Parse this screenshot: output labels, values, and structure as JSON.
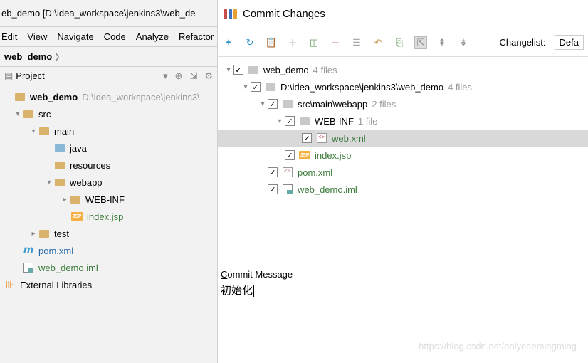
{
  "left": {
    "title": "eb_demo [D:\\idea_workspace\\jenkins3\\web_de",
    "menu": [
      "Edit",
      "View",
      "Navigate",
      "Code",
      "Analyze",
      "Refactor"
    ],
    "breadcrumb": "web_demo",
    "project_header": "Project",
    "tree": {
      "root": {
        "name": "web_demo",
        "path": "D:\\idea_workspace\\jenkins3\\"
      },
      "src": "src",
      "main": "main",
      "java": "java",
      "resources": "resources",
      "webapp": "webapp",
      "webinf": "WEB-INF",
      "indexjsp": "index.jsp",
      "test": "test",
      "pom": "pom.xml",
      "iml": "web_demo.iml",
      "ext": "External Libraries"
    }
  },
  "dialog": {
    "title": "Commit Changes",
    "changelist_label": "Changelist:",
    "changelist_value": "Defa",
    "tree": {
      "root": {
        "name": "web_demo",
        "count": "4 files"
      },
      "path": {
        "name": "D:\\idea_workspace\\jenkins3\\web_demo",
        "count": "4 files"
      },
      "webapp": {
        "name": "src\\main\\webapp",
        "count": "2 files"
      },
      "webinf": {
        "name": "WEB-INF",
        "count": "1 file"
      },
      "webxml": "web.xml",
      "indexjsp": "index.jsp",
      "pom": "pom.xml",
      "iml": "web_demo.iml"
    },
    "commit_label": "Commit Message",
    "commit_value": "初始化"
  },
  "watermark": "https://blog.csdn.net/onlyonemingming"
}
